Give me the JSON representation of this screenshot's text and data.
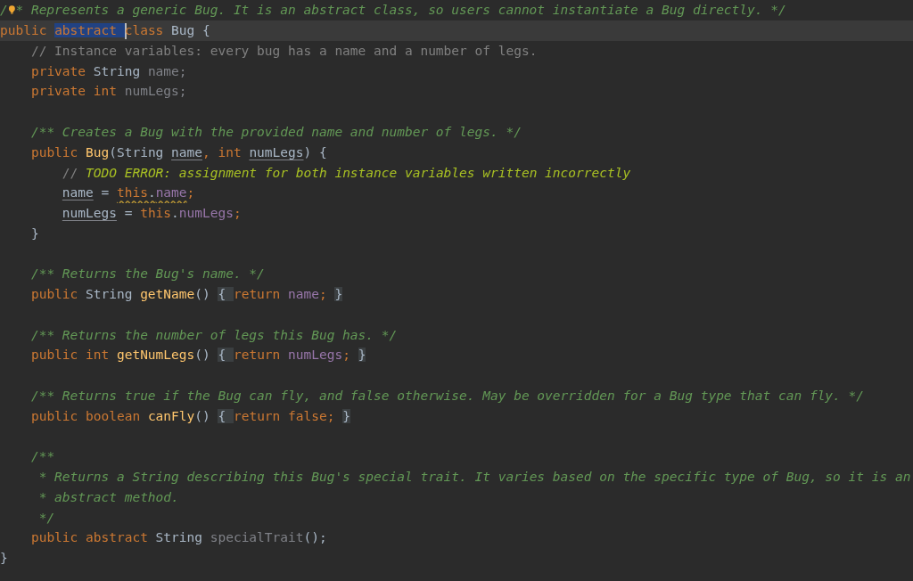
{
  "editor": {
    "lines": [
      {
        "current": false,
        "tokens": [
          {
            "text": "/",
            "kind": "doc"
          },
          {
            "kind": "bulb"
          },
          {
            "text": "* Represents a generic Bug. It is an abstract class, so users cannot instantiate a Bug directly. */",
            "kind": "doc"
          }
        ]
      },
      {
        "current": true,
        "tokens": [
          {
            "text": "public",
            "kind": "keyword"
          },
          {
            "text": " abstract ",
            "kind": "selection"
          },
          {
            "kind": "caret"
          },
          {
            "text": "class",
            "kind": "keyword"
          },
          {
            "text": " Bug {",
            "kind": "plain"
          }
        ]
      },
      {
        "current": false,
        "tokens": [
          {
            "text": "    // Instance variables: every bug has a name and a number of legs.",
            "kind": "comment"
          }
        ]
      },
      {
        "current": false,
        "tokens": [
          {
            "text": "    private",
            "kind": "keyword"
          },
          {
            "text": " String ",
            "kind": "plain"
          },
          {
            "text": "name;",
            "kind": "unused"
          }
        ]
      },
      {
        "current": false,
        "tokens": [
          {
            "text": "    private int ",
            "kind": "keyword"
          },
          {
            "text": "numLegs;",
            "kind": "unused"
          }
        ]
      },
      {
        "current": false
      },
      {
        "current": false,
        "tokens": [
          {
            "text": "    /** Creates a Bug with the provided name and number of legs. */",
            "kind": "doc"
          }
        ]
      },
      {
        "current": false,
        "tokens": [
          {
            "text": "    public ",
            "kind": "keyword"
          },
          {
            "text": "Bug",
            "kind": "method"
          },
          {
            "text": "(String ",
            "kind": "plain"
          },
          {
            "text": "name",
            "kind": "param"
          },
          {
            "text": ", int ",
            "kind": "keyword"
          },
          {
            "text": "numLegs",
            "kind": "param"
          },
          {
            "text": ") {",
            "kind": "plain"
          }
        ]
      },
      {
        "current": false,
        "tokens": [
          {
            "text": "        // ",
            "kind": "comment"
          },
          {
            "text": "TODO ERROR: assignment for both instance variables written incorrectly",
            "kind": "todo"
          }
        ]
      },
      {
        "current": false,
        "tokens": [
          {
            "text": "        name",
            "kind": "param"
          },
          {
            "text": " = ",
            "kind": "plain"
          },
          {
            "text": "this",
            "kind": "keyword_warn"
          },
          {
            "text": ".",
            "kind": "plain_warn"
          },
          {
            "text": "name",
            "kind": "field_warn"
          },
          {
            "text": ";",
            "kind": "keyword"
          }
        ]
      },
      {
        "current": false,
        "tokens": [
          {
            "text": "        numLegs",
            "kind": "param"
          },
          {
            "text": " = ",
            "kind": "plain"
          },
          {
            "text": "this",
            "kind": "keyword"
          },
          {
            "text": ".",
            "kind": "plain"
          },
          {
            "text": "numLegs",
            "kind": "field"
          },
          {
            "text": ";",
            "kind": "keyword"
          }
        ]
      },
      {
        "current": false,
        "tokens": [
          {
            "text": "    }",
            "kind": "plain"
          }
        ]
      },
      {
        "current": false
      },
      {
        "current": false,
        "tokens": [
          {
            "text": "    /** Returns the Bug's name. */",
            "kind": "doc"
          }
        ]
      },
      {
        "current": false,
        "tokens": [
          {
            "text": "    public ",
            "kind": "keyword"
          },
          {
            "text": "String ",
            "kind": "plain"
          },
          {
            "text": "getName",
            "kind": "method"
          },
          {
            "text": "() ",
            "kind": "plain"
          },
          {
            "text": "{ ",
            "kind": "fold"
          },
          {
            "text": "return ",
            "kind": "keyword"
          },
          {
            "text": "name",
            "kind": "field"
          },
          {
            "text": ";",
            "kind": "keyword"
          },
          {
            "text": " }",
            "kind": "fold"
          }
        ]
      },
      {
        "current": false
      },
      {
        "current": false,
        "tokens": [
          {
            "text": "    /** Returns the number of legs this Bug has. */",
            "kind": "doc"
          }
        ]
      },
      {
        "current": false,
        "tokens": [
          {
            "text": "    public int ",
            "kind": "keyword"
          },
          {
            "text": "getNumLegs",
            "kind": "method"
          },
          {
            "text": "() ",
            "kind": "plain"
          },
          {
            "text": "{ ",
            "kind": "fold"
          },
          {
            "text": "return ",
            "kind": "keyword"
          },
          {
            "text": "numLegs",
            "kind": "field"
          },
          {
            "text": ";",
            "kind": "keyword"
          },
          {
            "text": " }",
            "kind": "fold"
          }
        ]
      },
      {
        "current": false
      },
      {
        "current": false,
        "tokens": [
          {
            "text": "    /** Returns true if the Bug can fly, and false otherwise. May be overridden for a Bug type that can fly. */",
            "kind": "doc"
          }
        ]
      },
      {
        "current": false,
        "tokens": [
          {
            "text": "    public boolean ",
            "kind": "keyword"
          },
          {
            "text": "canFly",
            "kind": "method"
          },
          {
            "text": "() ",
            "kind": "plain"
          },
          {
            "text": "{ ",
            "kind": "fold"
          },
          {
            "text": "return false;",
            "kind": "keyword"
          },
          {
            "text": " }",
            "kind": "fold"
          }
        ]
      },
      {
        "current": false
      },
      {
        "current": false,
        "tokens": [
          {
            "text": "    /**",
            "kind": "doc"
          }
        ]
      },
      {
        "current": false,
        "tokens": [
          {
            "text": "     * Returns a String describing this Bug's special trait. It varies based on the specific type of Bug, so it is an",
            "kind": "doc"
          }
        ]
      },
      {
        "current": false,
        "tokens": [
          {
            "text": "     * abstract method.",
            "kind": "doc"
          }
        ]
      },
      {
        "current": false,
        "tokens": [
          {
            "text": "     */",
            "kind": "doc"
          }
        ]
      },
      {
        "current": false,
        "tokens": [
          {
            "text": "    public abstract ",
            "kind": "keyword"
          },
          {
            "text": "String ",
            "kind": "plain"
          },
          {
            "text": "specialTrait",
            "kind": "unused"
          },
          {
            "text": "();",
            "kind": "plain"
          }
        ]
      },
      {
        "current": false,
        "tokens": [
          {
            "text": "}",
            "kind": "plain"
          }
        ]
      }
    ]
  }
}
